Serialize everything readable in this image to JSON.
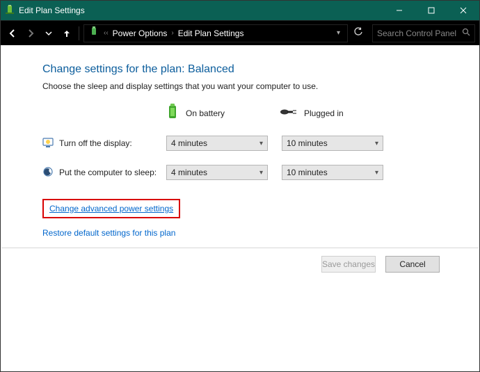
{
  "window": {
    "title": "Edit Plan Settings"
  },
  "breadcrumb": {
    "first": "Power Options",
    "second": "Edit Plan Settings"
  },
  "search": {
    "placeholder": "Search Control Panel"
  },
  "page": {
    "heading": "Change settings for the plan: Balanced",
    "sub": "Choose the sleep and display settings that you want your computer to use.",
    "col_battery": "On battery",
    "col_plugged": "Plugged in",
    "row_display": "Turn off the display:",
    "row_sleep": "Put the computer to sleep:",
    "display_battery": "4 minutes",
    "display_plugged": "10 minutes",
    "sleep_battery": "4 minutes",
    "sleep_plugged": "10 minutes",
    "link_advanced": "Change advanced power settings",
    "link_restore": "Restore default settings for this plan"
  },
  "footer": {
    "save": "Save changes",
    "cancel": "Cancel"
  }
}
